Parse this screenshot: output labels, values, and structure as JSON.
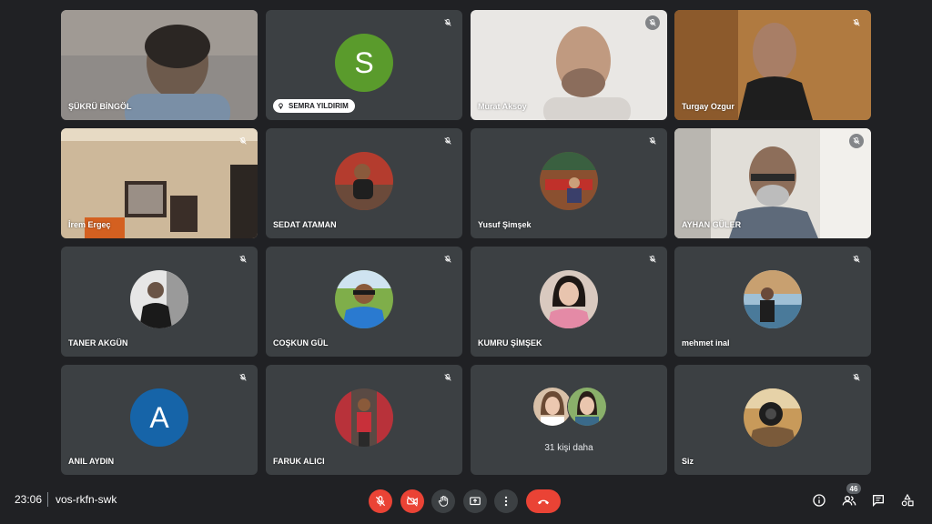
{
  "colors": {
    "background": "#202124",
    "tile": "#3c4043",
    "danger": "#ea4335",
    "avatar_green": "#5a9b2c",
    "avatar_blue": "#1664a8"
  },
  "participants": [
    {
      "name": "ŞÜKRÜ BİNGÖL",
      "type": "video"
    },
    {
      "name": "SEMRA YILDIRIM",
      "type": "letter",
      "letter": "S"
    },
    {
      "name": "Murat Aksoy",
      "type": "video"
    },
    {
      "name": "Turgay Ozgur",
      "type": "video"
    },
    {
      "name": "İrem Ergeç",
      "type": "video"
    },
    {
      "name": "SEDAT ATAMAN",
      "type": "avatar"
    },
    {
      "name": "Yusuf Şimşek",
      "type": "avatar"
    },
    {
      "name": "AYHAN GÜLER",
      "type": "video"
    },
    {
      "name": "TANER AKGÜN",
      "type": "avatar"
    },
    {
      "name": "COŞKUN GÜL",
      "type": "avatar"
    },
    {
      "name": "KUMRU ŞİMŞEK",
      "type": "avatar"
    },
    {
      "name": "mehmet inal",
      "type": "avatar"
    },
    {
      "name": "ANIL AYDIN",
      "type": "letter",
      "letter": "A"
    },
    {
      "name": "FARUK ALICI",
      "type": "avatar"
    },
    {
      "name": "Siz",
      "type": "avatar"
    }
  ],
  "more": {
    "label": "31 kişi daha"
  },
  "meeting": {
    "time": "23:06",
    "code": "vos-rkfn-swk"
  },
  "controls": [
    {
      "icon": "mic-off-icon"
    },
    {
      "icon": "camera-off-icon"
    },
    {
      "icon": "raise-hand-icon"
    },
    {
      "icon": "present-screen-icon"
    },
    {
      "icon": "more-options-icon"
    },
    {
      "icon": "end-call-icon"
    }
  ],
  "right_controls": [
    {
      "icon": "info-icon"
    },
    {
      "icon": "people-icon",
      "badge": "46"
    },
    {
      "icon": "chat-icon"
    },
    {
      "icon": "activities-icon"
    }
  ]
}
